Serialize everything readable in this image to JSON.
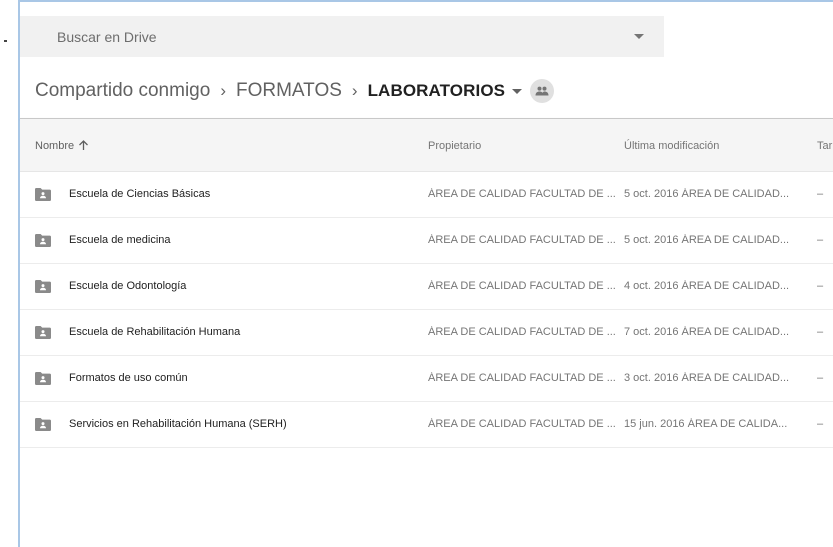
{
  "search": {
    "placeholder": "Buscar en Drive"
  },
  "breadcrumb": {
    "items": [
      "Compartido conmigo",
      "FORMATOS"
    ],
    "separator": "›",
    "current": "LABORATORIOS"
  },
  "table": {
    "headers": {
      "name": "Nombre",
      "owner": "Propietario",
      "modified": "Última modificación",
      "size": "Tar"
    },
    "rows": [
      {
        "name": "Escuela de Ciencias Básicas",
        "owner": "ÁREA DE CALIDAD FACULTAD DE ...",
        "modified": "5 oct. 2016 ÁREA DE CALIDAD...",
        "size": "–"
      },
      {
        "name": "Escuela de medicina",
        "owner": "ÁREA DE CALIDAD FACULTAD DE ...",
        "modified": "5 oct. 2016 ÁREA DE CALIDAD...",
        "size": "–"
      },
      {
        "name": "Escuela de Odontología",
        "owner": "ÁREA DE CALIDAD FACULTAD DE ...",
        "modified": "4 oct. 2016 ÁREA DE CALIDAD...",
        "size": "–"
      },
      {
        "name": "Escuela de Rehabilitación Humana",
        "owner": "ÁREA DE CALIDAD FACULTAD DE ...",
        "modified": "7 oct. 2016 ÁREA DE CALIDAD...",
        "size": "–"
      },
      {
        "name": "Formatos de uso común",
        "owner": "ÁREA DE CALIDAD FACULTAD DE ...",
        "modified": "3 oct. 2016 ÁREA DE CALIDAD...",
        "size": "–"
      },
      {
        "name": "Servicios en Rehabilitación Humana (SERH)",
        "owner": "ÁREA DE CALIDAD FACULTAD DE ...",
        "modified": "15 jun. 2016 ÁREA DE CALIDA...",
        "size": "–"
      }
    ]
  },
  "icons": {
    "folder": "shared-folder-icon",
    "sort": "arrow-up-icon",
    "shared": "people-icon",
    "dropdown": "caret-down-icon"
  },
  "colors": {
    "folder": "#8a8a8a",
    "frame": "#a9c7e6",
    "search_bg": "#f1f1f1",
    "header_bg": "#f5f5f5"
  }
}
